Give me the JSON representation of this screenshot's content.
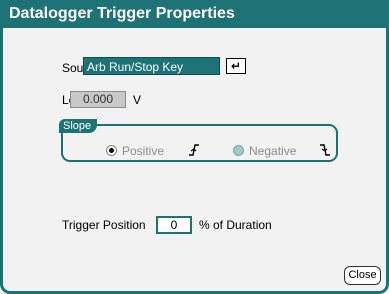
{
  "window": {
    "title": "Datalogger Trigger Properties"
  },
  "source": {
    "label": "Source",
    "value": "Arb Run/Stop Key",
    "enter_glyph": "↵"
  },
  "level": {
    "label": "Level",
    "value": "0.000",
    "unit": "V"
  },
  "slope": {
    "label": "Slope",
    "options": [
      {
        "label": "Positive",
        "selected": true
      },
      {
        "label": "Negative",
        "selected": false
      }
    ]
  },
  "trigger_position": {
    "label": "Trigger Position",
    "value": "0",
    "unit": "% of Duration"
  },
  "close_button": {
    "label": "Close"
  },
  "colors": {
    "accent": "#1d7276",
    "background": "#f2f2f2"
  }
}
